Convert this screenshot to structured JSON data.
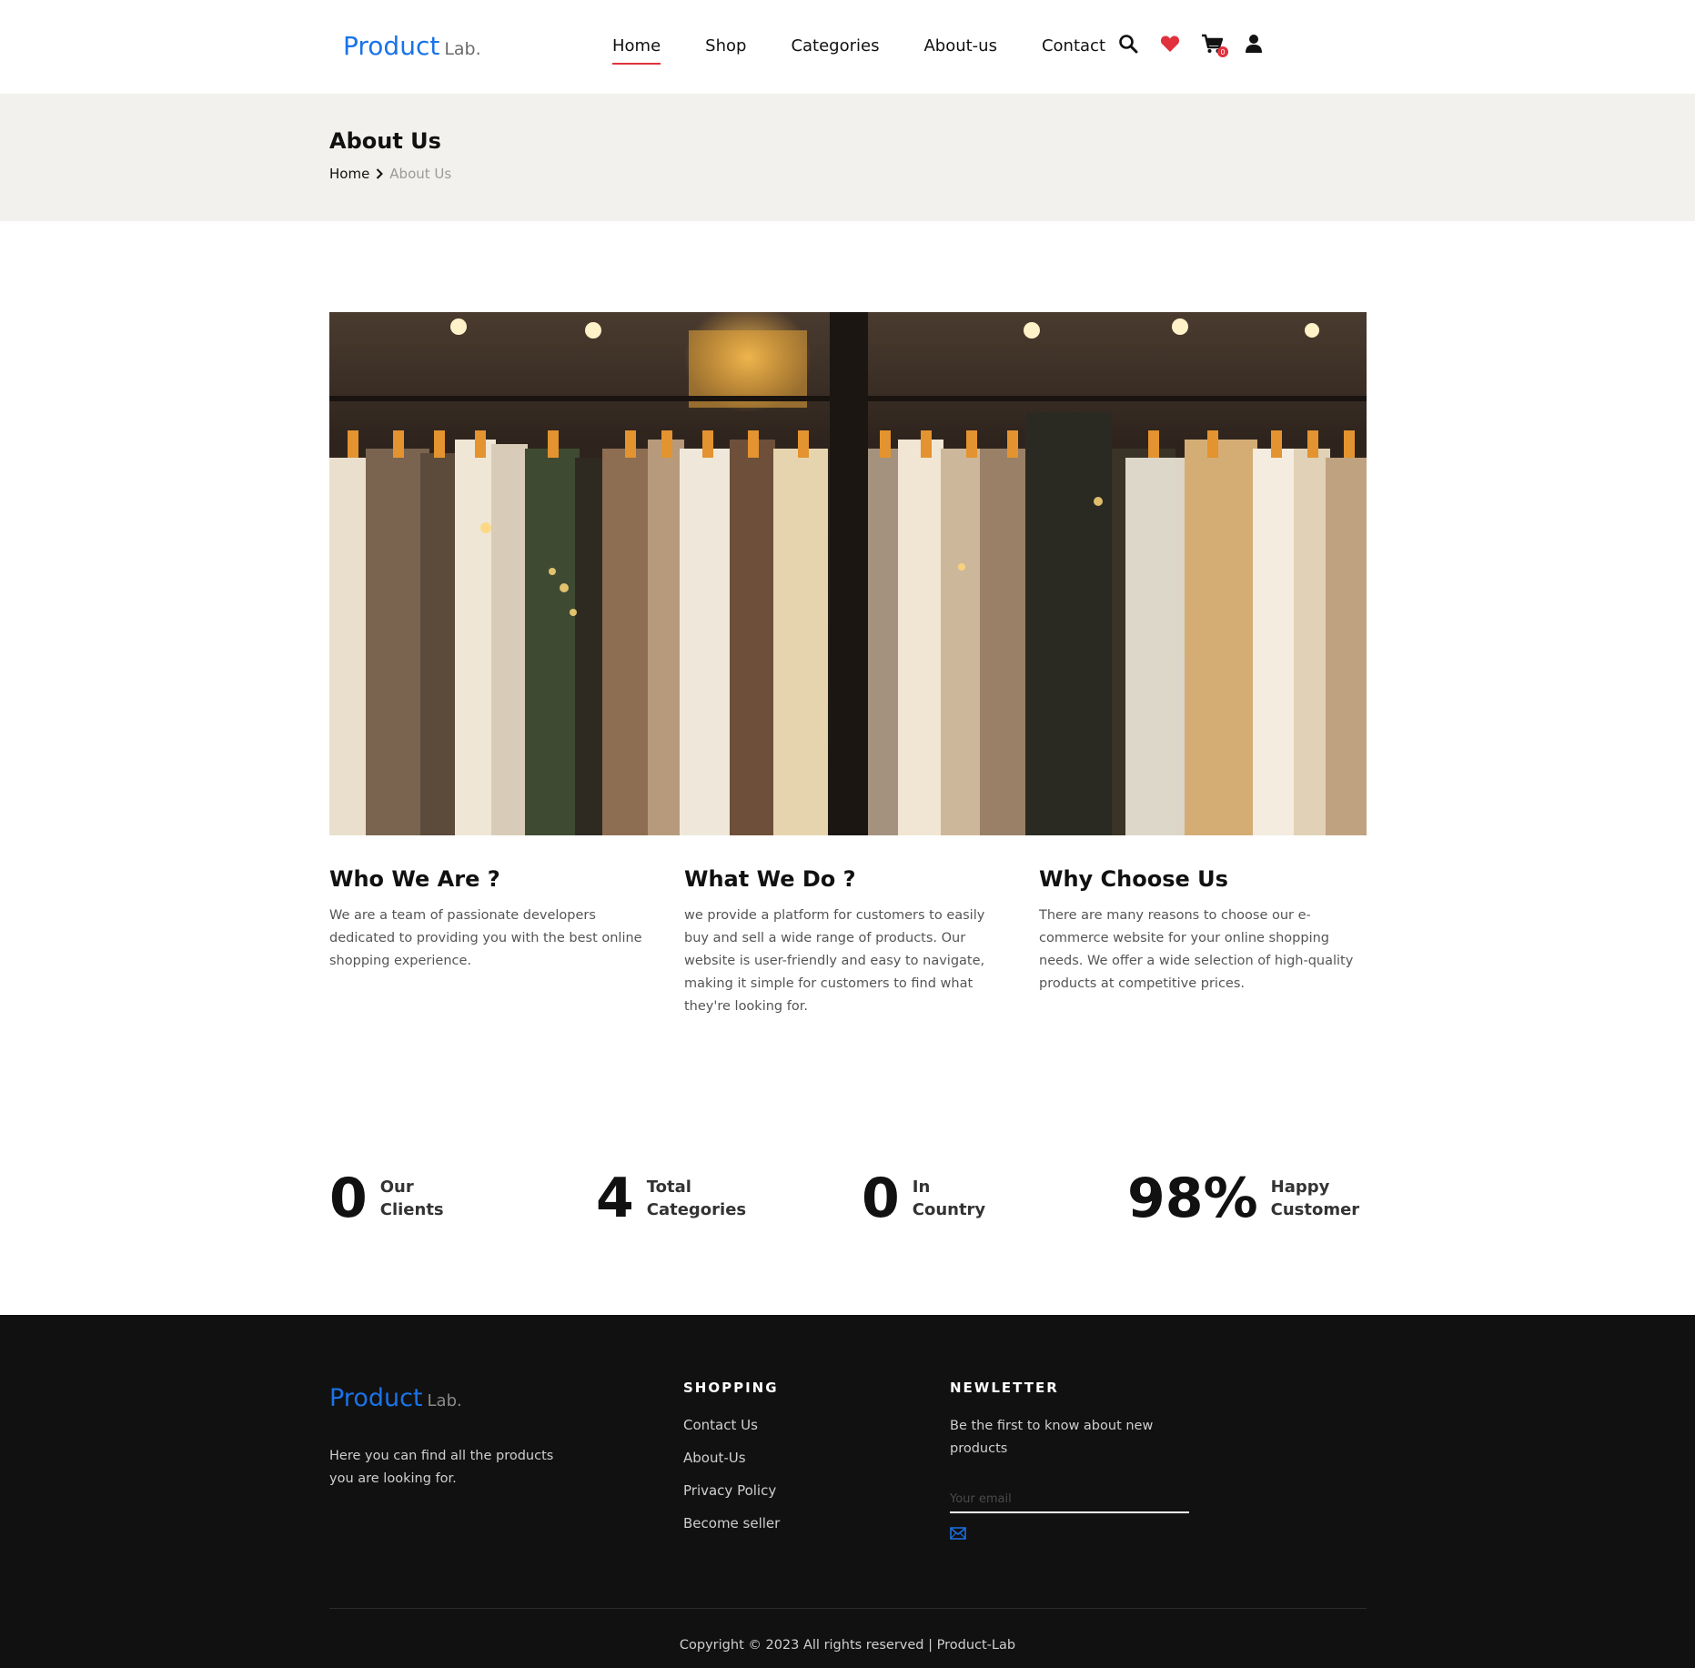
{
  "header": {
    "logo_brand": "Product",
    "logo_sub": "Lab.",
    "nav": [
      {
        "label": "Home",
        "active": true
      },
      {
        "label": "Shop"
      },
      {
        "label": "Categories"
      },
      {
        "label": "About-us"
      },
      {
        "label": "Contact"
      }
    ],
    "icons": [
      "search-icon",
      "heart-icon",
      "cart-icon",
      "user-icon"
    ],
    "cart_count": "0",
    "colors": {
      "brand": "#1a73e8",
      "accent": "#e0313c"
    }
  },
  "title_band": {
    "title": "About Us",
    "breadcrumb_home": "Home",
    "breadcrumb_current": "About Us"
  },
  "info": [
    {
      "title": "Who We Are ?",
      "text": "We are a team of passionate developers dedicated to providing you with the best online shopping experience."
    },
    {
      "title": "What We Do ?",
      "text": "we provide a platform for customers to easily buy and sell a wide range of products. Our website is user-friendly and easy to navigate, making it simple for customers to find what they're looking for."
    },
    {
      "title": "Why Choose Us",
      "text": "There are many reasons to choose our e-commerce website for your online shopping needs. We offer a wide selection of high-quality products at competitive prices."
    }
  ],
  "stats": [
    {
      "value": "0",
      "line1": "Our",
      "line2": "Clients"
    },
    {
      "value": "4",
      "line1": "Total",
      "line2": "Categories"
    },
    {
      "value": "0",
      "line1": "In",
      "line2": "Country"
    },
    {
      "value": "98%",
      "line1": "Happy",
      "line2": "Customer"
    }
  ],
  "footer": {
    "logo_brand": "Product",
    "logo_sub": "Lab.",
    "description": "Here you can find all the products you are looking for.",
    "shopping_heading": "SHOPPING",
    "links": [
      "Contact Us",
      "About-Us",
      "Privacy Policy",
      "Become seller"
    ],
    "newsletter_heading": "NEWLETTER",
    "newsletter_text": "Be the first to know about new products",
    "email_placeholder": "Your email",
    "copyright": "Copyright © 2023 All rights reserved | Product-Lab"
  }
}
